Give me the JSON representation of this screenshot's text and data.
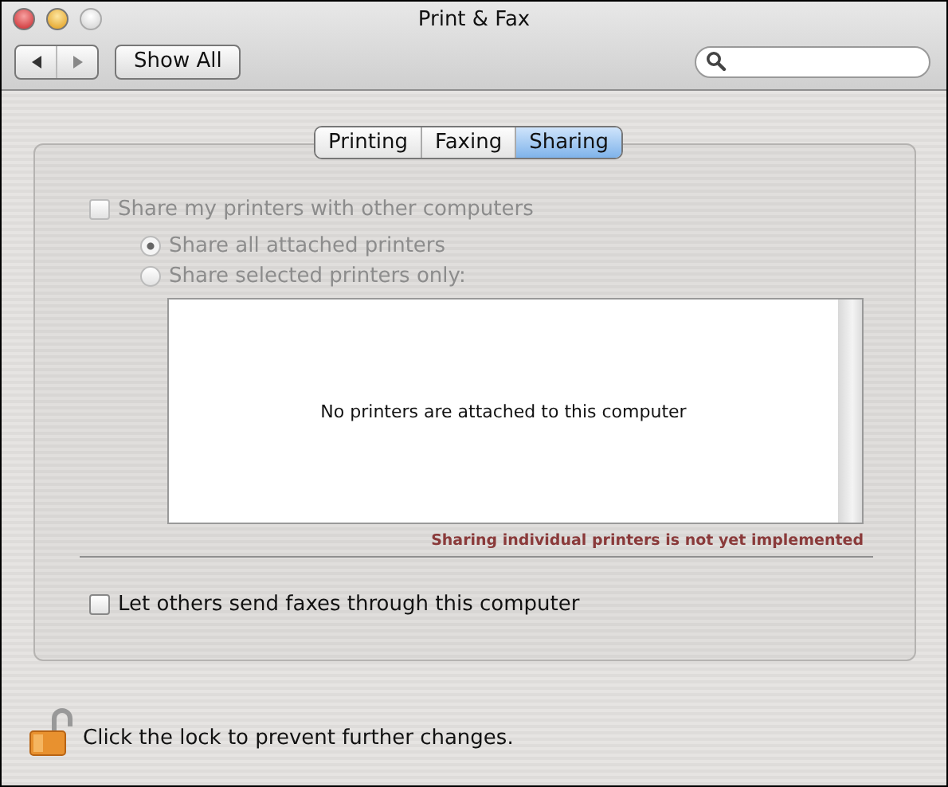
{
  "window": {
    "title": "Print & Fax",
    "controls": [
      {
        "kind": "close"
      },
      {
        "kind": "minimize"
      },
      {
        "kind": "zoom"
      }
    ]
  },
  "toolbar": {
    "show_all": "Show All"
  },
  "tabs": [
    {
      "label": "Printing",
      "selected": false
    },
    {
      "label": "Faxing",
      "selected": false
    },
    {
      "label": "Sharing",
      "selected": true
    }
  ],
  "share_printers": {
    "label": "Share my printers with other computers",
    "checked": false,
    "disabled": true
  },
  "share_options": [
    {
      "label": "Share all attached printers",
      "selected": true,
      "disabled": true
    },
    {
      "label": "Share selected printers only:",
      "selected": false,
      "disabled": true
    }
  ],
  "printer_list": {
    "empty_text": "No printers are attached to this computer"
  },
  "note": "Sharing individual printers is not yet implemented",
  "fax_sharing": {
    "label": "Let others send faxes through this computer",
    "checked": false,
    "disabled": false
  },
  "lock": {
    "text": "Click the lock to prevent further changes.",
    "locked": false
  }
}
